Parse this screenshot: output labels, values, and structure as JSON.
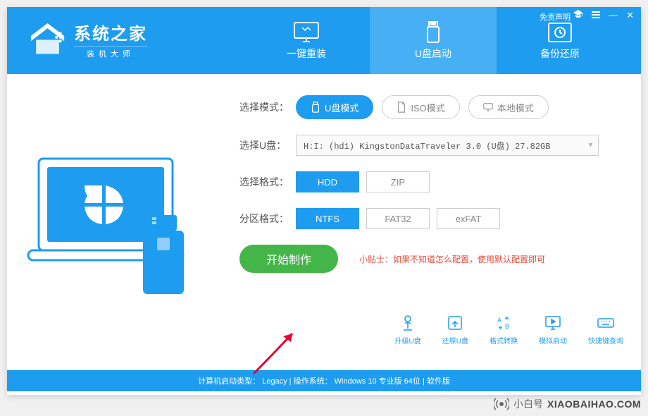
{
  "brand": {
    "title": "系统之家",
    "subtitle": "装机大师"
  },
  "title_controls": {
    "disclaimer": "免责声明"
  },
  "tabs": [
    {
      "label": "一键重装"
    },
    {
      "label": "U盘启动"
    },
    {
      "label": "备份还原"
    }
  ],
  "form": {
    "mode_label": "选择模式：",
    "modes": [
      {
        "label": "U盘模式"
      },
      {
        "label": "ISO模式"
      },
      {
        "label": "本地模式"
      }
    ],
    "udisk_label": "选择U盘：",
    "udisk_value": "H:I: (hd1) KingstonDataTraveler 3.0 (U盘) 27.82GB",
    "format_label": "选择格式：",
    "formats": [
      "HDD",
      "ZIP"
    ],
    "partition_label": "分区格式：",
    "partitions": [
      "NTFS",
      "FAT32",
      "exFAT"
    ],
    "start_button": "开始制作",
    "tip": "小贴士：如果不知道怎么配置，使用默认配置即可"
  },
  "tools": [
    {
      "label": "升级U盘"
    },
    {
      "label": "还原U盘"
    },
    {
      "label": "格式转换"
    },
    {
      "label": "模拟启动"
    },
    {
      "label": "快捷键查询"
    }
  ],
  "status": "计算机启动类型： Legacy | 操作系统： Windows 10 专业版 64位 | 软件版",
  "footer": {
    "brand_cn": "小白号",
    "domain": "XIAOBAIHAO.COM"
  }
}
